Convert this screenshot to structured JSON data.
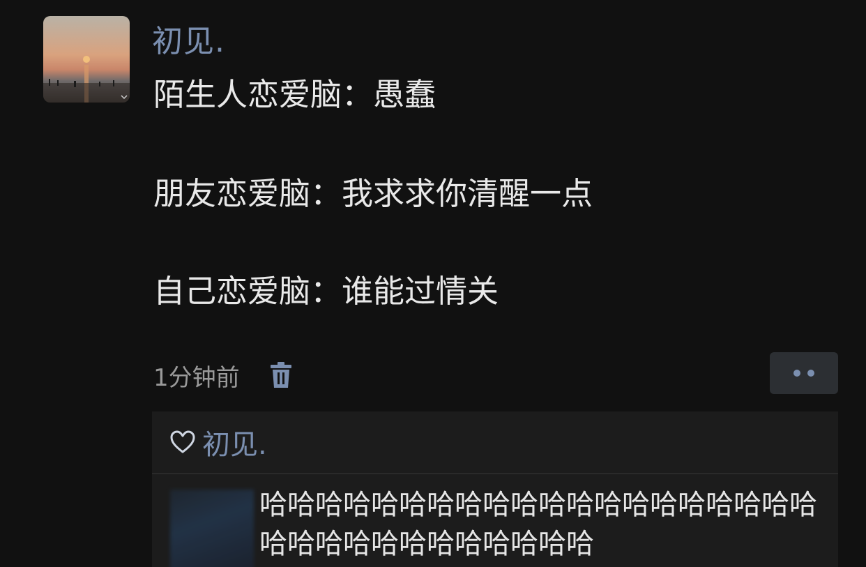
{
  "post": {
    "username": "初见.",
    "lines": [
      "陌生人恋爱脑：愚蠢",
      "朋友恋爱脑：我求求你清醒一点",
      "自己恋爱脑：谁能过情关"
    ],
    "timestamp": "1分钟前",
    "delete_icon": "trash-icon",
    "more_icon": "more-dots-icon"
  },
  "likes": {
    "icon": "heart-outline-icon",
    "names": "初见."
  },
  "comment": {
    "text": "哈哈哈哈哈哈哈哈哈哈哈哈哈哈哈哈哈哈哈哈哈哈哈哈哈哈哈哈哈哈哈哈"
  },
  "colors": {
    "background": "#111111",
    "name_blue": "#7b8fb0",
    "panel": "#1c1c1c",
    "text": "#e9e9e9",
    "meta": "#9a9a9a"
  }
}
